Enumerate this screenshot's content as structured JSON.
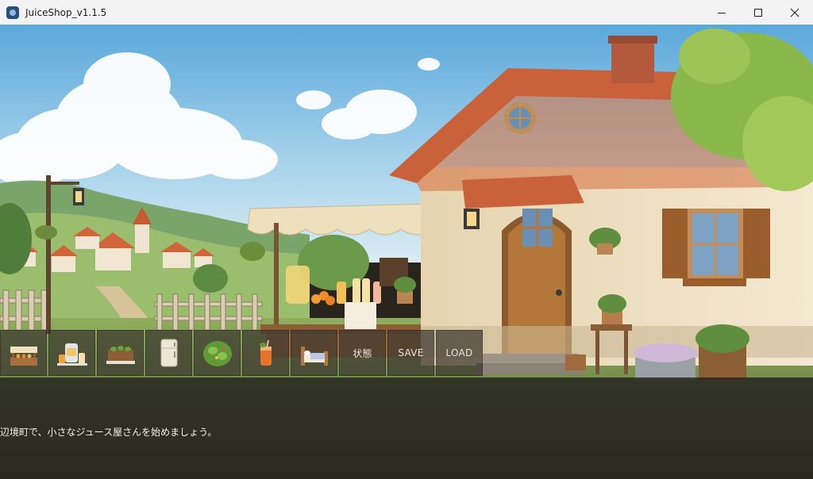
{
  "window": {
    "title": "JuiceShop_v1.1.5",
    "controls": {
      "minimize": "minimize-icon",
      "maximize": "maximize-icon",
      "close": "close-icon"
    }
  },
  "toolbar": {
    "buttons": [
      {
        "icon": "juice-stand-icon"
      },
      {
        "icon": "juicer-tools-icon"
      },
      {
        "icon": "planter-box-icon"
      },
      {
        "icon": "refrigerator-icon"
      },
      {
        "icon": "vegetable-garden-icon"
      },
      {
        "icon": "juice-glass-icon"
      },
      {
        "icon": "bed-icon"
      }
    ],
    "status_label": "状態",
    "save_label": "SAVE",
    "load_label": "LOAD"
  },
  "message": {
    "text": "辺境町で、小さなジュース屋さんを始めましょう。"
  },
  "colors": {
    "sky": "#6fb4de",
    "roof": "#c9623a",
    "wall": "#efe2c6",
    "door": "#a66a2c",
    "message_box": "#221e1b"
  }
}
